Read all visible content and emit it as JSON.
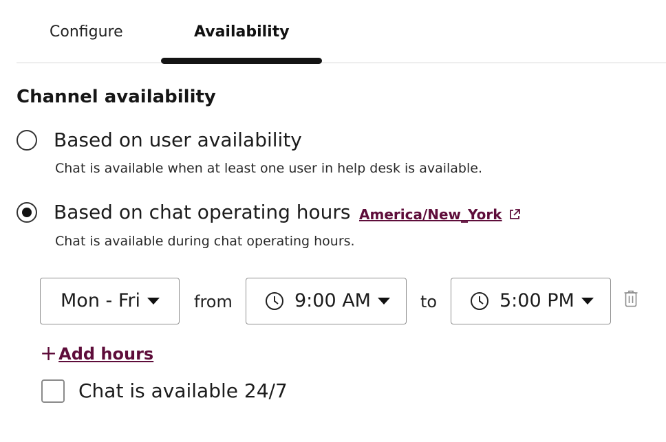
{
  "tabs": {
    "configure": "Configure",
    "availability": "Availability",
    "active": "Availability"
  },
  "section": {
    "title": "Channel availability"
  },
  "options": {
    "user": {
      "label": "Based on user availability",
      "description": "Chat is available when at least one user in help desk is available.",
      "selected": false
    },
    "hours": {
      "label": "Based on chat operating hours",
      "description": "Chat is available during chat operating hours.",
      "timezone": "America/New_York",
      "selected": true
    }
  },
  "schedule": {
    "days": "Mon - Fri",
    "from_label": "from",
    "start_time": "9:00 AM",
    "to_label": "to",
    "end_time": "5:00 PM"
  },
  "add_hours": {
    "label": "Add hours"
  },
  "always_available": {
    "label": "Chat is available 24/7",
    "checked": false
  },
  "colors": {
    "accent": "#5e0d3a",
    "text": "#1c1c1c",
    "border": "#8e8e8e",
    "divider": "#d6d6d6"
  },
  "icons": {
    "external_link": "external-link-icon",
    "clock": "clock-icon",
    "trash": "trash-icon",
    "plus": "plus-icon",
    "caret": "caret-down-icon"
  }
}
